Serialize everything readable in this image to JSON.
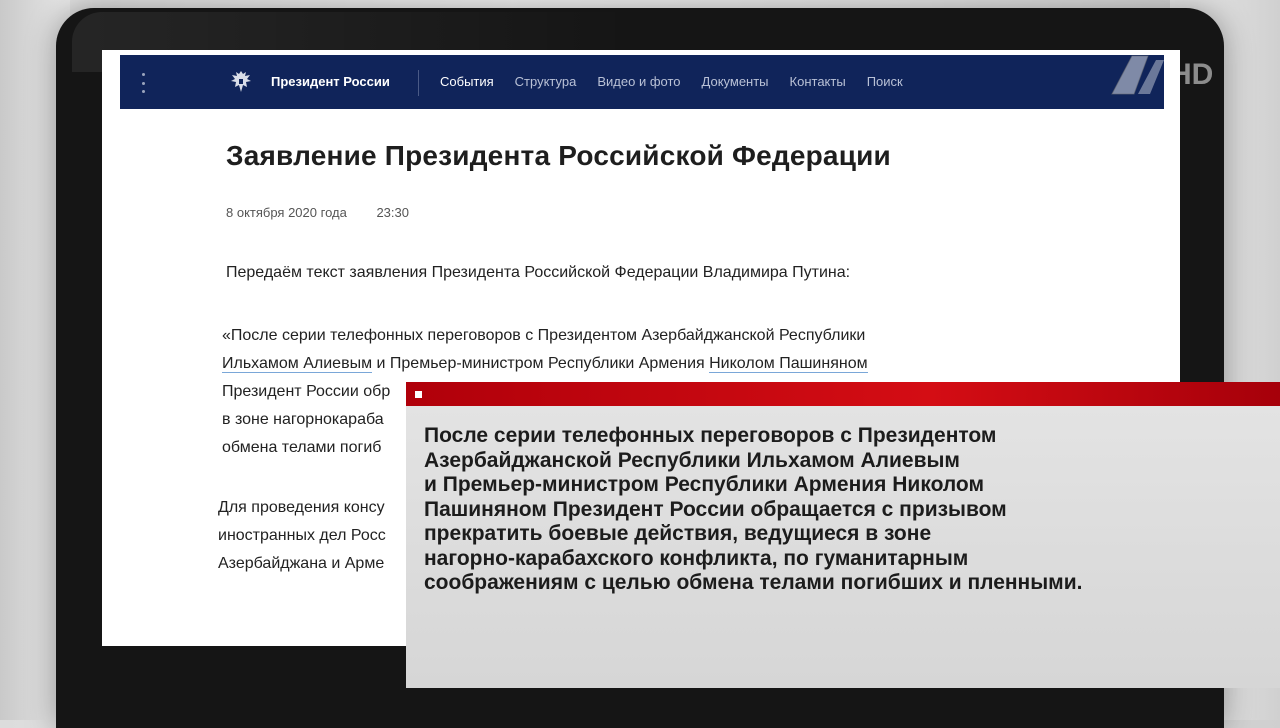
{
  "navbar": {
    "site_name": "Президент России",
    "items": [
      "События",
      "Структура",
      "Видео и фото",
      "Документы",
      "Контакты",
      "Поиск"
    ]
  },
  "page": {
    "title": "Заявление Президента Российской Федерации",
    "date": "8 октября 2020 года",
    "time": "23:30",
    "lead": "Передаём текст заявления Президента Российской Федерации Владимира Путина:",
    "quote_lines": [
      "«После серии телефонных переговоров с Президентом Азербайджанской Республики",
      "Ильхамом Алиевым и Премьер-министром Республики Армения Николом Пашиняном",
      "Президент России обр",
      "в зоне нагорнокараба",
      "обмена телами погиб"
    ],
    "quote_line2_parts": [
      "Ильхамом Алиевым",
      " и Премьер-министром Республики Армения ",
      "Николом Пашиняном"
    ],
    "para2_lines": [
      "Для проведения консу",
      "иностранных дел Росс",
      "Азербайджана и Арме"
    ]
  },
  "channel_logo": {
    "text": "HD"
  },
  "caption": {
    "lines": [
      "После серии телефонных переговоров с Президентом",
      "Азербайджанской Республики Ильхамом Алиевым",
      "и Премьер-министром Республики Армения Николом",
      "Пашиняном Президент России обращается с призывом",
      "прекратить боевые действия, ведущиеся в зоне",
      "нагорно-карабахского конфликта, по гуманитарным",
      "соображениям с целью обмена телами погибших и пленными."
    ]
  },
  "colors": {
    "navbar": "#10245a",
    "caption_red": "#d40d14",
    "caption_bg": "#dcdcdc"
  }
}
